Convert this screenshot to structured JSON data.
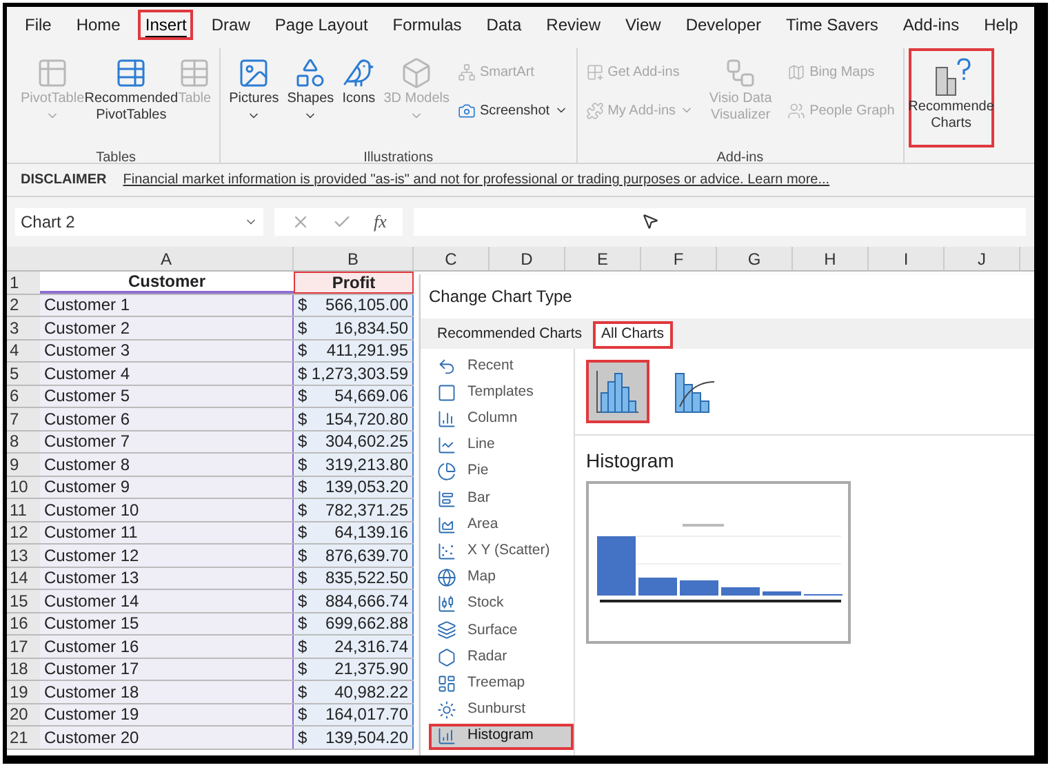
{
  "ribbon_tabs": [
    {
      "label": "File",
      "selected": false,
      "highlighted": false
    },
    {
      "label": "Home",
      "selected": false,
      "highlighted": false
    },
    {
      "label": "Insert",
      "selected": true,
      "highlighted": true
    },
    {
      "label": "Draw",
      "selected": false,
      "highlighted": false
    },
    {
      "label": "Page Layout",
      "selected": false,
      "highlighted": false
    },
    {
      "label": "Formulas",
      "selected": false,
      "highlighted": false
    },
    {
      "label": "Data",
      "selected": false,
      "highlighted": false
    },
    {
      "label": "Review",
      "selected": false,
      "highlighted": false
    },
    {
      "label": "View",
      "selected": false,
      "highlighted": false
    },
    {
      "label": "Developer",
      "selected": false,
      "highlighted": false
    },
    {
      "label": "Time Savers",
      "selected": false,
      "highlighted": false
    },
    {
      "label": "Add-ins",
      "selected": false,
      "highlighted": false
    },
    {
      "label": "Help",
      "selected": false,
      "highlighted": false
    }
  ],
  "ribbon_groups": [
    {
      "label": "Tables",
      "buttons": [
        {
          "kind": "large",
          "label": "PivotTable",
          "disabled": true,
          "dropdown": true,
          "highlighted": false
        },
        {
          "kind": "large",
          "label": "Recommended PivotTables",
          "disabled": false,
          "dropdown": false,
          "highlighted": false
        },
        {
          "kind": "large",
          "label": "Table",
          "disabled": true,
          "dropdown": false,
          "highlighted": false
        }
      ]
    },
    {
      "label": "Illustrations",
      "buttons": [
        {
          "kind": "large",
          "label": "Pictures",
          "disabled": false,
          "dropdown": true,
          "highlighted": false
        },
        {
          "kind": "large",
          "label": "Shapes",
          "disabled": false,
          "dropdown": true,
          "highlighted": false
        },
        {
          "kind": "large",
          "label": "Icons",
          "disabled": false,
          "dropdown": false,
          "highlighted": false
        },
        {
          "kind": "large",
          "label": "3D Models",
          "disabled": true,
          "dropdown": true,
          "highlighted": false
        },
        {
          "kind": "small",
          "label": "SmartArt",
          "disabled": true,
          "dropdown": false,
          "highlighted": false
        },
        {
          "kind": "small",
          "label": "Screenshot",
          "disabled": false,
          "dropdown": true,
          "highlighted": false
        }
      ]
    },
    {
      "label": "Add-ins",
      "buttons": [
        {
          "kind": "small",
          "label": "Get Add-ins",
          "disabled": true,
          "dropdown": false,
          "highlighted": false
        },
        {
          "kind": "small",
          "label": "My Add-ins",
          "disabled": true,
          "dropdown": true,
          "highlighted": false
        },
        {
          "kind": "large",
          "label": "Visio Data Visualizer",
          "disabled": true,
          "dropdown": false,
          "highlighted": false
        },
        {
          "kind": "small",
          "label": "Bing Maps",
          "disabled": true,
          "dropdown": false,
          "highlighted": false
        },
        {
          "kind": "small",
          "label": "People Graph",
          "disabled": true,
          "dropdown": false,
          "highlighted": false
        }
      ]
    },
    {
      "buttons": [
        {
          "kind": "large",
          "label": "Recommende Charts",
          "disabled": false,
          "dropdown": false,
          "highlighted": true
        }
      ]
    }
  ],
  "disclaimer": {
    "label": "DISCLAIMER",
    "link": "Financial market information is provided \"as-is\" and not for professional or trading purposes or advice. Learn more..."
  },
  "formula_bar": {
    "name_box": "Chart 2",
    "function_label": "fx"
  },
  "columns": [
    "A",
    "B",
    "C",
    "D",
    "E",
    "F",
    "G",
    "H",
    "I",
    "J"
  ],
  "header_row": {
    "row": "1",
    "customer": "Customer",
    "profit": "Profit"
  },
  "rows": [
    {
      "row": "2",
      "customer": "Customer 1",
      "currency": "$",
      "amount": "566,105.00"
    },
    {
      "row": "3",
      "customer": "Customer 2",
      "currency": "$",
      "amount": "16,834.50"
    },
    {
      "row": "4",
      "customer": "Customer 3",
      "currency": "$",
      "amount": "411,291.95"
    },
    {
      "row": "5",
      "customer": "Customer 4",
      "currency": "$",
      "amount": "1,273,303.59"
    },
    {
      "row": "6",
      "customer": "Customer 5",
      "currency": "$",
      "amount": "54,669.06"
    },
    {
      "row": "7",
      "customer": "Customer 6",
      "currency": "$",
      "amount": "154,720.80"
    },
    {
      "row": "8",
      "customer": "Customer 7",
      "currency": "$",
      "amount": "304,602.25"
    },
    {
      "row": "9",
      "customer": "Customer 8",
      "currency": "$",
      "amount": "319,213.80"
    },
    {
      "row": "10",
      "customer": "Customer 9",
      "currency": "$",
      "amount": "139,053.20"
    },
    {
      "row": "11",
      "customer": "Customer 10",
      "currency": "$",
      "amount": "782,371.25"
    },
    {
      "row": "12",
      "customer": "Customer 11",
      "currency": "$",
      "amount": "64,139.16"
    },
    {
      "row": "13",
      "customer": "Customer 12",
      "currency": "$",
      "amount": "876,639.70"
    },
    {
      "row": "14",
      "customer": "Customer 13",
      "currency": "$",
      "amount": "835,522.50"
    },
    {
      "row": "15",
      "customer": "Customer 14",
      "currency": "$",
      "amount": "884,666.74"
    },
    {
      "row": "16",
      "customer": "Customer 15",
      "currency": "$",
      "amount": "699,662.88"
    },
    {
      "row": "17",
      "customer": "Customer 16",
      "currency": "$",
      "amount": "24,316.74"
    },
    {
      "row": "18",
      "customer": "Customer 17",
      "currency": "$",
      "amount": "21,375.90"
    },
    {
      "row": "19",
      "customer": "Customer 18",
      "currency": "$",
      "amount": "40,982.22"
    },
    {
      "row": "20",
      "customer": "Customer 19",
      "currency": "$",
      "amount": "164,017.70"
    },
    {
      "row": "21",
      "customer": "Customer 20",
      "currency": "$",
      "amount": "139,504.20"
    }
  ],
  "dialog": {
    "title": "Change Chart Type",
    "tabs": [
      {
        "label": "Recommended Charts",
        "selected": false,
        "highlighted": false
      },
      {
        "label": "All Charts",
        "selected": true,
        "highlighted": true
      }
    ],
    "chart_types": [
      {
        "label": "Recent",
        "selected": false,
        "highlighted": false
      },
      {
        "label": "Templates",
        "selected": false,
        "highlighted": false
      },
      {
        "label": "Column",
        "selected": false,
        "highlighted": false
      },
      {
        "label": "Line",
        "selected": false,
        "highlighted": false
      },
      {
        "label": "Pie",
        "selected": false,
        "highlighted": false
      },
      {
        "label": "Bar",
        "selected": false,
        "highlighted": false
      },
      {
        "label": "Area",
        "selected": false,
        "highlighted": false
      },
      {
        "label": "X Y (Scatter)",
        "selected": false,
        "highlighted": false
      },
      {
        "label": "Map",
        "selected": false,
        "highlighted": false
      },
      {
        "label": "Stock",
        "selected": false,
        "highlighted": false
      },
      {
        "label": "Surface",
        "selected": false,
        "highlighted": false
      },
      {
        "label": "Radar",
        "selected": false,
        "highlighted": false
      },
      {
        "label": "Treemap",
        "selected": false,
        "highlighted": false
      },
      {
        "label": "Sunburst",
        "selected": false,
        "highlighted": false
      },
      {
        "label": "Histogram",
        "selected": true,
        "highlighted": true
      }
    ],
    "subtypes": [
      {
        "selected": true,
        "highlighted": true
      },
      {
        "selected": false,
        "highlighted": false
      }
    ],
    "preview_title": "Histogram"
  }
}
